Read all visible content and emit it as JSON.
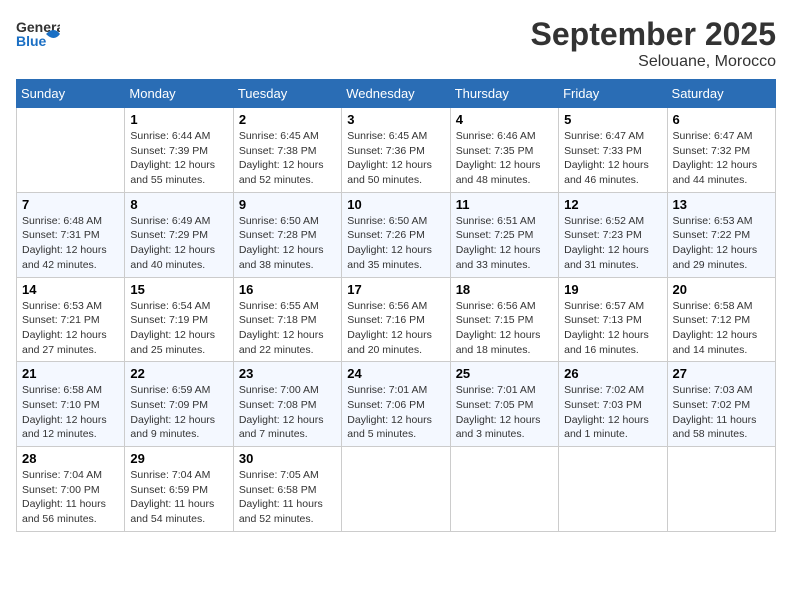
{
  "header": {
    "logo_general": "General",
    "logo_blue": "Blue",
    "month": "September 2025",
    "location": "Selouane, Morocco"
  },
  "days_of_week": [
    "Sunday",
    "Monday",
    "Tuesday",
    "Wednesday",
    "Thursday",
    "Friday",
    "Saturday"
  ],
  "weeks": [
    [
      {
        "day": "",
        "info": ""
      },
      {
        "day": "1",
        "info": "Sunrise: 6:44 AM\nSunset: 7:39 PM\nDaylight: 12 hours\nand 55 minutes."
      },
      {
        "day": "2",
        "info": "Sunrise: 6:45 AM\nSunset: 7:38 PM\nDaylight: 12 hours\nand 52 minutes."
      },
      {
        "day": "3",
        "info": "Sunrise: 6:45 AM\nSunset: 7:36 PM\nDaylight: 12 hours\nand 50 minutes."
      },
      {
        "day": "4",
        "info": "Sunrise: 6:46 AM\nSunset: 7:35 PM\nDaylight: 12 hours\nand 48 minutes."
      },
      {
        "day": "5",
        "info": "Sunrise: 6:47 AM\nSunset: 7:33 PM\nDaylight: 12 hours\nand 46 minutes."
      },
      {
        "day": "6",
        "info": "Sunrise: 6:47 AM\nSunset: 7:32 PM\nDaylight: 12 hours\nand 44 minutes."
      }
    ],
    [
      {
        "day": "7",
        "info": "Sunrise: 6:48 AM\nSunset: 7:31 PM\nDaylight: 12 hours\nand 42 minutes."
      },
      {
        "day": "8",
        "info": "Sunrise: 6:49 AM\nSunset: 7:29 PM\nDaylight: 12 hours\nand 40 minutes."
      },
      {
        "day": "9",
        "info": "Sunrise: 6:50 AM\nSunset: 7:28 PM\nDaylight: 12 hours\nand 38 minutes."
      },
      {
        "day": "10",
        "info": "Sunrise: 6:50 AM\nSunset: 7:26 PM\nDaylight: 12 hours\nand 35 minutes."
      },
      {
        "day": "11",
        "info": "Sunrise: 6:51 AM\nSunset: 7:25 PM\nDaylight: 12 hours\nand 33 minutes."
      },
      {
        "day": "12",
        "info": "Sunrise: 6:52 AM\nSunset: 7:23 PM\nDaylight: 12 hours\nand 31 minutes."
      },
      {
        "day": "13",
        "info": "Sunrise: 6:53 AM\nSunset: 7:22 PM\nDaylight: 12 hours\nand 29 minutes."
      }
    ],
    [
      {
        "day": "14",
        "info": "Sunrise: 6:53 AM\nSunset: 7:21 PM\nDaylight: 12 hours\nand 27 minutes."
      },
      {
        "day": "15",
        "info": "Sunrise: 6:54 AM\nSunset: 7:19 PM\nDaylight: 12 hours\nand 25 minutes."
      },
      {
        "day": "16",
        "info": "Sunrise: 6:55 AM\nSunset: 7:18 PM\nDaylight: 12 hours\nand 22 minutes."
      },
      {
        "day": "17",
        "info": "Sunrise: 6:56 AM\nSunset: 7:16 PM\nDaylight: 12 hours\nand 20 minutes."
      },
      {
        "day": "18",
        "info": "Sunrise: 6:56 AM\nSunset: 7:15 PM\nDaylight: 12 hours\nand 18 minutes."
      },
      {
        "day": "19",
        "info": "Sunrise: 6:57 AM\nSunset: 7:13 PM\nDaylight: 12 hours\nand 16 minutes."
      },
      {
        "day": "20",
        "info": "Sunrise: 6:58 AM\nSunset: 7:12 PM\nDaylight: 12 hours\nand 14 minutes."
      }
    ],
    [
      {
        "day": "21",
        "info": "Sunrise: 6:58 AM\nSunset: 7:10 PM\nDaylight: 12 hours\nand 12 minutes."
      },
      {
        "day": "22",
        "info": "Sunrise: 6:59 AM\nSunset: 7:09 PM\nDaylight: 12 hours\nand 9 minutes."
      },
      {
        "day": "23",
        "info": "Sunrise: 7:00 AM\nSunset: 7:08 PM\nDaylight: 12 hours\nand 7 minutes."
      },
      {
        "day": "24",
        "info": "Sunrise: 7:01 AM\nSunset: 7:06 PM\nDaylight: 12 hours\nand 5 minutes."
      },
      {
        "day": "25",
        "info": "Sunrise: 7:01 AM\nSunset: 7:05 PM\nDaylight: 12 hours\nand 3 minutes."
      },
      {
        "day": "26",
        "info": "Sunrise: 7:02 AM\nSunset: 7:03 PM\nDaylight: 12 hours\nand 1 minute."
      },
      {
        "day": "27",
        "info": "Sunrise: 7:03 AM\nSunset: 7:02 PM\nDaylight: 11 hours\nand 58 minutes."
      }
    ],
    [
      {
        "day": "28",
        "info": "Sunrise: 7:04 AM\nSunset: 7:00 PM\nDaylight: 11 hours\nand 56 minutes."
      },
      {
        "day": "29",
        "info": "Sunrise: 7:04 AM\nSunset: 6:59 PM\nDaylight: 11 hours\nand 54 minutes."
      },
      {
        "day": "30",
        "info": "Sunrise: 7:05 AM\nSunset: 6:58 PM\nDaylight: 11 hours\nand 52 minutes."
      },
      {
        "day": "",
        "info": ""
      },
      {
        "day": "",
        "info": ""
      },
      {
        "day": "",
        "info": ""
      },
      {
        "day": "",
        "info": ""
      }
    ]
  ]
}
